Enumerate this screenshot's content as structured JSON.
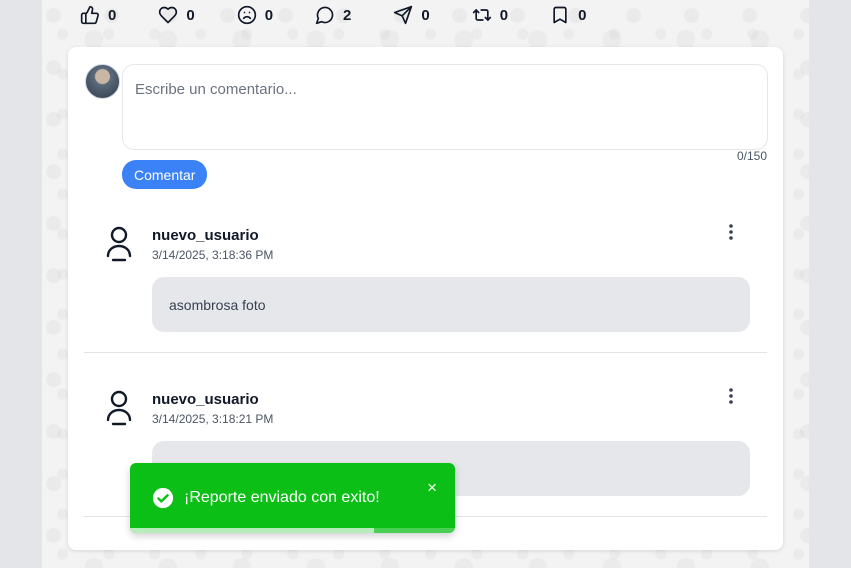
{
  "reactions": [
    {
      "icon": "like-icon",
      "count": "0"
    },
    {
      "icon": "heart-icon",
      "count": "0"
    },
    {
      "icon": "sad-face-icon",
      "count": "0"
    },
    {
      "icon": "comment-icon",
      "count": "2"
    },
    {
      "icon": "send-icon",
      "count": "0"
    },
    {
      "icon": "repost-icon",
      "count": "0"
    },
    {
      "icon": "bookmark-icon",
      "count": "0"
    }
  ],
  "composer": {
    "placeholder": "Escribe un comentario...",
    "value": "",
    "char_count": "0/150",
    "submit_label": "Comentar"
  },
  "comments": [
    {
      "username": "nuevo_usuario",
      "timestamp": "3/14/2025, 3:18:36 PM",
      "text": "asombrosa foto"
    },
    {
      "username": "nuevo_usuario",
      "timestamp": "3/14/2025, 3:18:21 PM",
      "text": ""
    }
  ],
  "toast": {
    "message": "¡Reporte enviado con exito!",
    "close_symbol": "×",
    "progress": 0.75,
    "color": "#0cbf17"
  },
  "colors": {
    "accent": "#3b82f6",
    "bubble": "#e5e7eb"
  }
}
